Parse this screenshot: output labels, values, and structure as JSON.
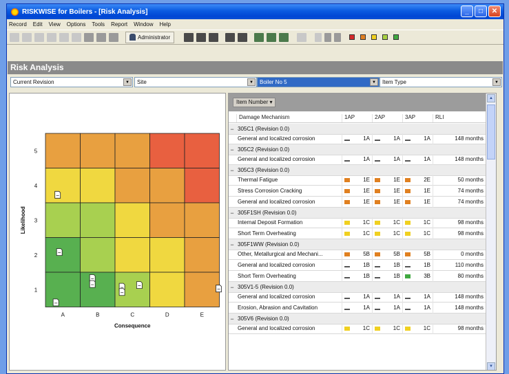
{
  "window": {
    "title": "RISKWISE for Boilers - [Risk Analysis]"
  },
  "menu": [
    "Record",
    "Edit",
    "View",
    "Options",
    "Tools",
    "Report",
    "Window",
    "Help"
  ],
  "toolbar": {
    "user": "Administrator",
    "status_colors": [
      "#d42a2a",
      "#e08020",
      "#f0d020",
      "#a8d040",
      "#40a840"
    ]
  },
  "page_title": "Risk Analysis",
  "filters": [
    {
      "value": "Current Revision"
    },
    {
      "value": "Site"
    },
    {
      "value": "Boiler No 5"
    },
    {
      "value": "Item Type"
    }
  ],
  "matrix": {
    "rows": [
      "5",
      "4",
      "3",
      "2",
      "1"
    ],
    "cols": [
      "A",
      "B",
      "C",
      "D",
      "E"
    ],
    "xlabel": "Consequence",
    "ylabel": "Likelihood",
    "colors": [
      [
        "#e8a040",
        "#e8a040",
        "#e8a040",
        "#e86040",
        "#e86040"
      ],
      [
        "#f0d840",
        "#f0d840",
        "#e8a040",
        "#e8a040",
        "#e86040"
      ],
      [
        "#a8d050",
        "#a8d050",
        "#f0d840",
        "#e8a040",
        "#e8a040"
      ],
      [
        "#58b050",
        "#a8d050",
        "#f0d840",
        "#f0d840",
        "#e8a040"
      ],
      [
        "#58b050",
        "#58b050",
        "#a8d050",
        "#f0d840",
        "#e8a040"
      ]
    ]
  },
  "grid": {
    "group_by": "Item Number",
    "columns": [
      "Damage Mechanism",
      "1AP",
      "2AP",
      "3AP",
      "RLI"
    ],
    "rows": [
      {
        "group": "305C1 (Revision 0.0)"
      },
      {
        "mech": "General and localized corrosion",
        "c": [
          "#555",
          "#555",
          "#555"
        ],
        "v": [
          "1A",
          "1A",
          "1A"
        ],
        "rli": "148 months"
      },
      {
        "group": "305C2 (Revision 0.0)"
      },
      {
        "mech": "General and localized corrosion",
        "c": [
          "#555",
          "#555",
          "#555"
        ],
        "v": [
          "1A",
          "1A",
          "1A"
        ],
        "rli": "148 months"
      },
      {
        "group": "305C3 (Revision 0.0)"
      },
      {
        "mech": "Thermal Fatigue",
        "c": [
          "#e08020",
          "#e08020",
          "#e08020"
        ],
        "v": [
          "1E",
          "1E",
          "2E"
        ],
        "rli": "50 months"
      },
      {
        "mech": "Stress Corrosion Cracking",
        "c": [
          "#e08020",
          "#e08020",
          "#e08020"
        ],
        "v": [
          "1E",
          "1E",
          "1E"
        ],
        "rli": "74 months"
      },
      {
        "mech": "General and localized corrosion",
        "c": [
          "#e08020",
          "#e08020",
          "#e08020"
        ],
        "v": [
          "1E",
          "1E",
          "1E"
        ],
        "rli": "74 months"
      },
      {
        "group": "305F1SH (Revision 0.0)"
      },
      {
        "mech": "Internal Deposit Formation",
        "c": [
          "#f0d020",
          "#f0d020",
          "#f0d020"
        ],
        "v": [
          "1C",
          "1C",
          "1C"
        ],
        "rli": "98 months"
      },
      {
        "mech": "Short Term Overheating",
        "c": [
          "#f0d020",
          "#f0d020",
          "#f0d020"
        ],
        "v": [
          "1C",
          "1C",
          "1C"
        ],
        "rli": "98 months"
      },
      {
        "group": "305F1WW (Revision 0.0)"
      },
      {
        "mech": "Other, Metallurgical and Mechani...",
        "c": [
          "#e08020",
          "#e08020",
          "#e08020"
        ],
        "v": [
          "5B",
          "5B",
          "5B"
        ],
        "rli": "0 months"
      },
      {
        "mech": "General and localized corrosion",
        "c": [
          "#555",
          "#555",
          "#555"
        ],
        "v": [
          "1B",
          "1B",
          "1B"
        ],
        "rli": "110 months"
      },
      {
        "mech": "Short Term Overheating",
        "c": [
          "#555",
          "#555",
          "#40a840"
        ],
        "v": [
          "1B",
          "1B",
          "3B"
        ],
        "rli": "80 months"
      },
      {
        "group": "305V1-5 (Revision 0.0)"
      },
      {
        "mech": "General and localized corrosion",
        "c": [
          "#555",
          "#555",
          "#555"
        ],
        "v": [
          "1A",
          "1A",
          "1A"
        ],
        "rli": "148 months"
      },
      {
        "mech": "Erosion, Abrasion and Cavitation",
        "c": [
          "#555",
          "#555",
          "#555"
        ],
        "v": [
          "1A",
          "1A",
          "1A"
        ],
        "rli": "148 months"
      },
      {
        "group": "305V6 (Revision 0.0)"
      },
      {
        "mech": "General and localized corrosion",
        "c": [
          "#f0d020",
          "#f0d020",
          "#f0d020"
        ],
        "v": [
          "1C",
          "1C",
          "1C"
        ],
        "rli": "98 months"
      }
    ]
  }
}
